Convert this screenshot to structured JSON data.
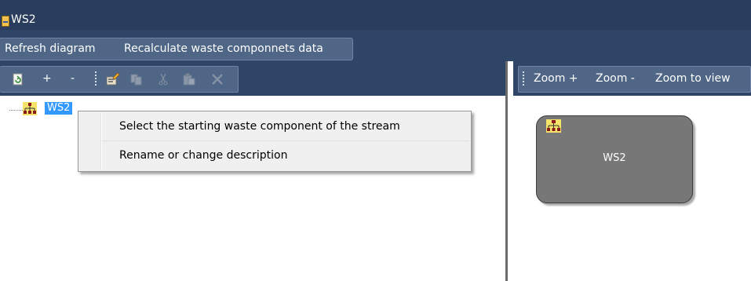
{
  "window": {
    "title": "WS2"
  },
  "menu": {
    "items": [
      {
        "label": "Refresh diagram"
      },
      {
        "label": "Recalculate waste componnets data"
      }
    ]
  },
  "tree_toolbar": {
    "icons": [
      "refresh-icon",
      "expand-plus",
      "collapse-minus",
      "properties-icon",
      "copy-icon",
      "cut-icon",
      "paste-icon",
      "delete-icon"
    ],
    "plus_label": "+",
    "minus_label": "-"
  },
  "diagram_toolbar": {
    "zoom_in": "Zoom +",
    "zoom_out": "Zoom -",
    "zoom_to_view": "Zoom to view"
  },
  "tree": {
    "root": {
      "label": "WS2",
      "icon": "hierarchy-icon",
      "selected": true
    }
  },
  "context_menu": {
    "items": [
      {
        "label": "Select the starting waste component of the stream"
      },
      {
        "label": "Rename or change description"
      }
    ]
  },
  "diagram": {
    "node": {
      "label": "WS2",
      "icon": "hierarchy-icon"
    }
  },
  "colors": {
    "title_bar": "#2b3d5c",
    "toolbar_band": "#2e4568",
    "toolbar": "#4f6687",
    "selection": "#3399ff",
    "node_fill": "#777777"
  }
}
